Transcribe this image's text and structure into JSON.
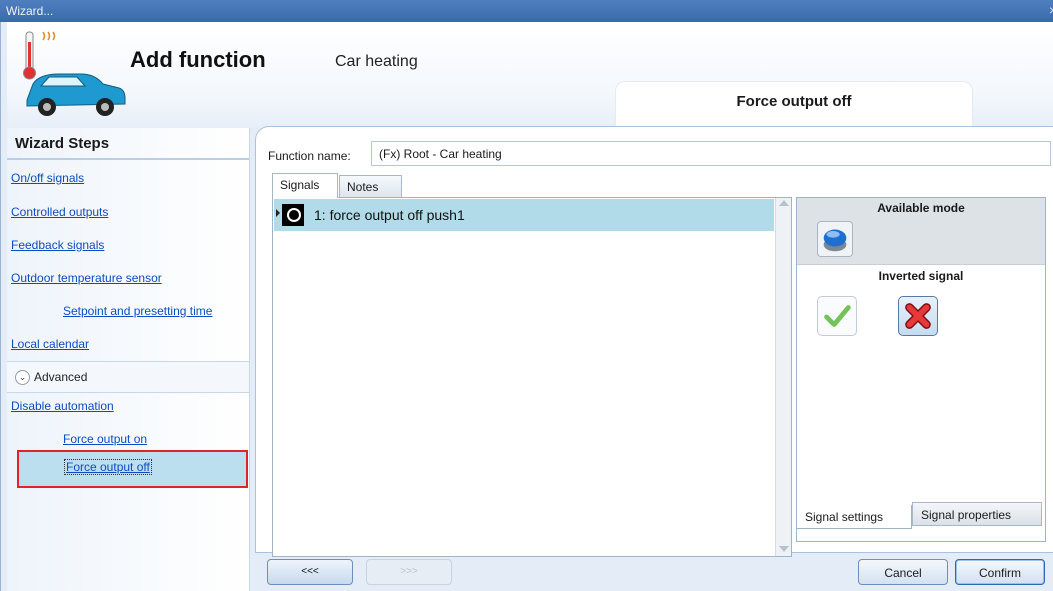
{
  "window": {
    "title": "Wizard...",
    "close_glyph": "×"
  },
  "header": {
    "title": "Add function",
    "subtitle": "Car heating",
    "current_step": "Force output off",
    "icon": "car-heating-icon"
  },
  "sidebar": {
    "heading": "Wizard Steps",
    "steps": [
      {
        "label": "On/off signals"
      },
      {
        "label": "Controlled outputs"
      },
      {
        "label": "Feedback signals"
      },
      {
        "label": "Outdoor temperature sensor"
      },
      {
        "label": "Setpoint and presetting time"
      },
      {
        "label": "Local calendar"
      }
    ],
    "advanced_label": "Advanced",
    "advanced_steps": [
      {
        "label": "Disable automation"
      },
      {
        "label": "Force output on"
      },
      {
        "label": "Force output off"
      }
    ],
    "selected_step": "Force output off",
    "highlight_color": "#e0242d"
  },
  "main": {
    "function_name_label": "Function name:",
    "function_name_value": "(Fx) Root - Car heating",
    "tabs": [
      {
        "label": "Signals",
        "active": true
      },
      {
        "label": "Notes",
        "active": false
      }
    ],
    "signals": [
      {
        "label": "1: force output off push1",
        "icon": "push-button-signal-icon"
      }
    ],
    "right_panel": {
      "available_mode_heading": "Available mode",
      "inverted_signal_heading": "Inverted signal",
      "inverted_selected": "no",
      "bottom_tabs": [
        {
          "label": "Signal settings",
          "active": true
        },
        {
          "label": "Signal properties",
          "active": false
        }
      ]
    }
  },
  "footer": {
    "back_label": "<<<",
    "forward_label": ">>>",
    "cancel_label": "Cancel",
    "confirm_label": "Confirm"
  }
}
